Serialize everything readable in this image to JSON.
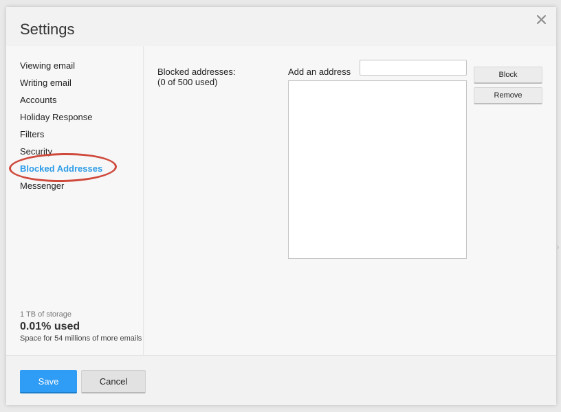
{
  "dialog": {
    "title": "Settings",
    "close_icon": "close-icon"
  },
  "sidebar": {
    "items": [
      {
        "label": "Viewing email",
        "active": false
      },
      {
        "label": "Writing email",
        "active": false
      },
      {
        "label": "Accounts",
        "active": false
      },
      {
        "label": "Holiday Response",
        "active": false
      },
      {
        "label": "Filters",
        "active": false
      },
      {
        "label": "Security",
        "active": false
      },
      {
        "label": "Blocked Addresses",
        "active": true
      },
      {
        "label": "Messenger",
        "active": false
      }
    ],
    "storage": {
      "capacity": "1 TB of storage",
      "used": "0.01% used",
      "note": "Space for 54 millions of more emails"
    }
  },
  "blocked": {
    "label_line1": "Blocked addresses:",
    "label_line2": "(0 of 500 used)",
    "add_label": "Add an address",
    "input_value": "",
    "block_button": "Block",
    "remove_button": "Remove",
    "addresses": []
  },
  "footer": {
    "save_label": "Save",
    "cancel_label": "Cancel"
  },
  "colors": {
    "accent": "#2c9ce8",
    "save_button": "#2f9cf5",
    "highlight_ellipse": "#cf4a3c"
  }
}
